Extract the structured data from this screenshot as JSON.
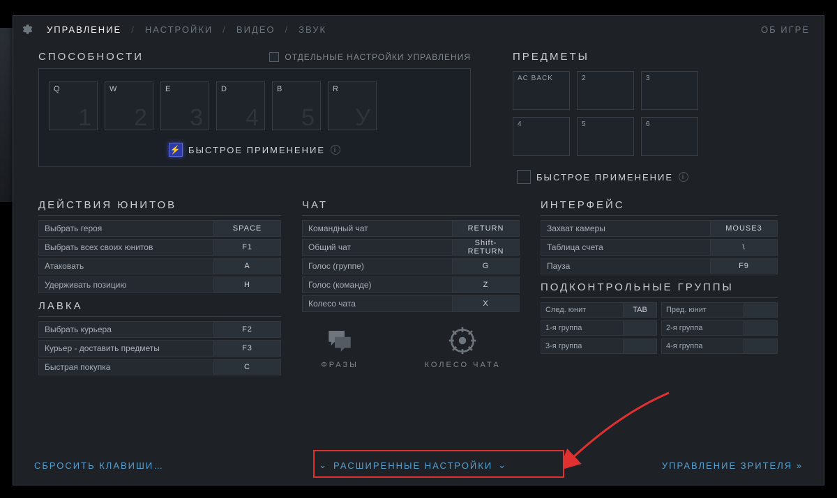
{
  "tabs": {
    "control": "УПРАВЛЕНИЕ",
    "settings": "НАСТРОЙКИ",
    "video": "ВИДЕО",
    "audio": "ЗВУК",
    "about": "ОБ ИГРЕ"
  },
  "abilities": {
    "title": "СПОСОБНОСТИ",
    "per_hero_checkbox": "ОТДЕЛЬНЫЕ НАСТРОЙКИ УПРАВЛЕНИЯ",
    "slots": [
      {
        "key": "Q",
        "idx": "1"
      },
      {
        "key": "W",
        "idx": "2"
      },
      {
        "key": "E",
        "idx": "3"
      },
      {
        "key": "D",
        "idx": "4"
      },
      {
        "key": "B",
        "idx": "5"
      },
      {
        "key": "R",
        "idx": "У"
      }
    ],
    "quickcast_label": "БЫСТРОЕ ПРИМЕНЕНИЕ"
  },
  "items": {
    "title": "ПРЕДМЕТЫ",
    "slots": [
      "AC BACK",
      "2",
      "3",
      "4",
      "5",
      "6"
    ],
    "quickcast_label": "БЫСТРОЕ ПРИМЕНЕНИЕ"
  },
  "unit_actions": {
    "title": "ДЕЙСТВИЯ ЮНИТОВ",
    "rows": [
      {
        "label": "Выбрать героя",
        "key": "SPACE"
      },
      {
        "label": "Выбрать всех своих юнитов",
        "key": "F1"
      },
      {
        "label": "Атаковать",
        "key": "A"
      },
      {
        "label": "Удерживать позицию",
        "key": "H"
      }
    ]
  },
  "shop": {
    "title": "ЛАВКА",
    "rows": [
      {
        "label": "Выбрать курьера",
        "key": "F2"
      },
      {
        "label": "Курьер - доставить предметы",
        "key": "F3"
      },
      {
        "label": "Быстрая покупка",
        "key": "C"
      }
    ]
  },
  "chat": {
    "title": "ЧАТ",
    "rows": [
      {
        "label": "Командный чат",
        "key": "RETURN"
      },
      {
        "label": "Общий чат",
        "key": "Shift- RETURN"
      },
      {
        "label": "Голос (группе)",
        "key": "G"
      },
      {
        "label": "Голос (команде)",
        "key": "Z"
      },
      {
        "label": "Колесо чата",
        "key": "X"
      }
    ],
    "phrases": "ФРАЗЫ",
    "wheel": "КОЛЕСО ЧАТА"
  },
  "interface": {
    "title": "ИНТЕРФЕЙС",
    "rows": [
      {
        "label": "Захват камеры",
        "key": "MOUSE3"
      },
      {
        "label": "Таблица счета",
        "key": "\\"
      },
      {
        "label": "Пауза",
        "key": "F9"
      }
    ]
  },
  "control_groups": {
    "title": "ПОДКОНТРОЛЬНЫЕ ГРУППЫ",
    "rows": [
      [
        {
          "label": "След. юнит",
          "key": "TAB"
        },
        {
          "label": "Пред. юнит",
          "key": ""
        }
      ],
      [
        {
          "label": "1-я группа",
          "key": ""
        },
        {
          "label": "2-я группа",
          "key": ""
        }
      ],
      [
        {
          "label": "3-я группа",
          "key": ""
        },
        {
          "label": "4-я группа",
          "key": ""
        }
      ]
    ]
  },
  "footer": {
    "reset": "СБРОСИТЬ КЛАВИШИ…",
    "advanced": "РАСШИРЕННЫЕ НАСТРОЙКИ",
    "spectator": "УПРАВЛЕНИЕ ЗРИТЕЛЯ"
  }
}
